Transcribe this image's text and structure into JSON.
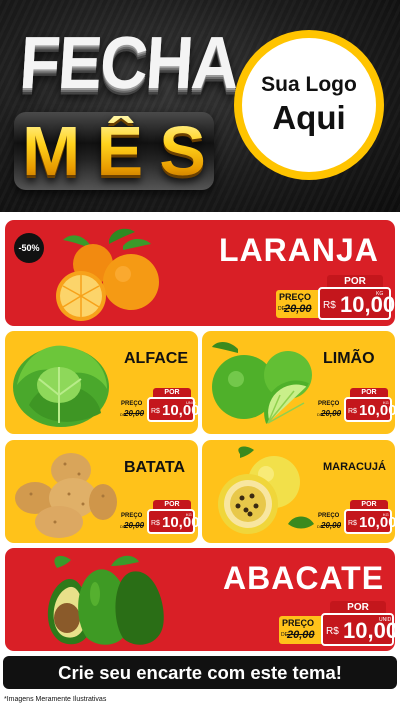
{
  "header": {
    "title_word1": "FECHA",
    "title_letters": [
      "M",
      "Ê",
      "S"
    ],
    "logo_line1": "Sua Logo",
    "logo_line2": "Aqui"
  },
  "colors": {
    "red": "#d91f26",
    "yellow": "#ffc21a",
    "gold": "#ffc400",
    "dark": "#111111"
  },
  "products": [
    {
      "name": "LARANJA",
      "badge": "-50%",
      "por": "POR",
      "preco_label": "PREÇO",
      "de": "DE",
      "old_price": "20,00",
      "currency": "R$",
      "price": "10,00",
      "unit": "KG",
      "icon": "orange-icon"
    },
    {
      "name": "ALFACE",
      "por": "POR",
      "preco_label": "PREÇO",
      "de": "DE",
      "old_price": "20,00",
      "currency": "R$",
      "price": "10,00",
      "unit": "UNID",
      "icon": "lettuce-icon"
    },
    {
      "name": "LIMÃO",
      "por": "POR",
      "preco_label": "PREÇO",
      "de": "DE",
      "old_price": "20,00",
      "currency": "R$",
      "price": "10,00",
      "unit": "KG",
      "icon": "lime-icon"
    },
    {
      "name": "BATATA",
      "por": "POR",
      "preco_label": "PREÇO",
      "de": "DE",
      "old_price": "20,00",
      "currency": "R$",
      "price": "10,00",
      "unit": "KG",
      "icon": "potato-icon"
    },
    {
      "name": "MARACUJÁ",
      "por": "POR",
      "preco_label": "PREÇO",
      "de": "DE",
      "old_price": "20,00",
      "currency": "R$",
      "price": "10,00",
      "unit": "KG",
      "icon": "passion-fruit-icon"
    },
    {
      "name": "ABACATE",
      "por": "POR",
      "preco_label": "PREÇO",
      "de": "DE",
      "old_price": "20,00",
      "currency": "R$",
      "price": "10,00",
      "unit": "UNID",
      "icon": "avocado-icon"
    }
  ],
  "footer": {
    "cta": "Crie seu encarte com este tema!",
    "disclaimer": "*Imagens Meramente Ilustrativas"
  }
}
